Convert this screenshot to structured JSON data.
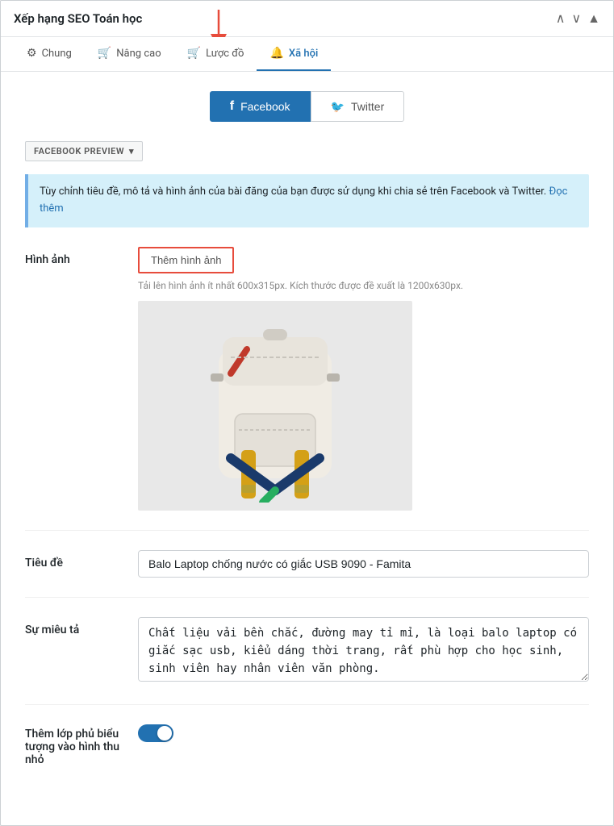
{
  "window": {
    "title": "Xếp hạng SEO Toán học",
    "controls": [
      "∧",
      "∨",
      "▲"
    ]
  },
  "tabs": [
    {
      "id": "chung",
      "label": "Chung",
      "icon": "⚙",
      "active": false
    },
    {
      "id": "nang-cao",
      "label": "Nâng cao",
      "icon": "🛒",
      "active": false
    },
    {
      "id": "luoc-do",
      "label": "Lược đồ",
      "icon": "🛒",
      "active": false
    },
    {
      "id": "xa-hoi",
      "label": "Xã hội",
      "icon": "🔔",
      "active": true
    }
  ],
  "social_tabs": [
    {
      "id": "facebook",
      "label": "Facebook",
      "active": true
    },
    {
      "id": "twitter",
      "label": "Twitter",
      "active": false
    }
  ],
  "preview_label": "FACEBOOK PREVIEW",
  "info_text": "Tùy chỉnh tiêu đề, mô tả và hình ảnh của bài đăng của bạn được sử dụng khi chia sẻ trên Facebook và Twitter.",
  "info_link": "Đọc thêm",
  "fields": {
    "hinh_anh": {
      "label": "Hình ảnh",
      "add_button": "Thêm hình ảnh",
      "hint": "Tải lên hình ảnh ít nhất 600x315px. Kích thước được đề xuất là 1200x630px."
    },
    "tieu_de": {
      "label": "Tiêu đề",
      "value": "Balo Laptop chống nước có giắc USB 9090 - Famita"
    },
    "su_mieu_ta": {
      "label": "Sự miêu tả",
      "value": "Chất liệu vải bền chắc, đường may tỉ mỉ, là loại balo laptop có giắc sạc usb, kiểu dáng thời trang, rất phù hợp cho học sinh, sinh viên hay nhân viên văn phòng."
    },
    "them_lop_phu": {
      "label": "Thêm lớp phủ biểu tượng vào hình thu nhỏ",
      "toggle": true
    }
  },
  "backpack": {
    "body_color": "#f0ece4",
    "strap_yellow": "#d4a017",
    "strap_blue": "#1a3a6b",
    "strap_red": "#c0392b",
    "strap_green": "#27ae60"
  }
}
